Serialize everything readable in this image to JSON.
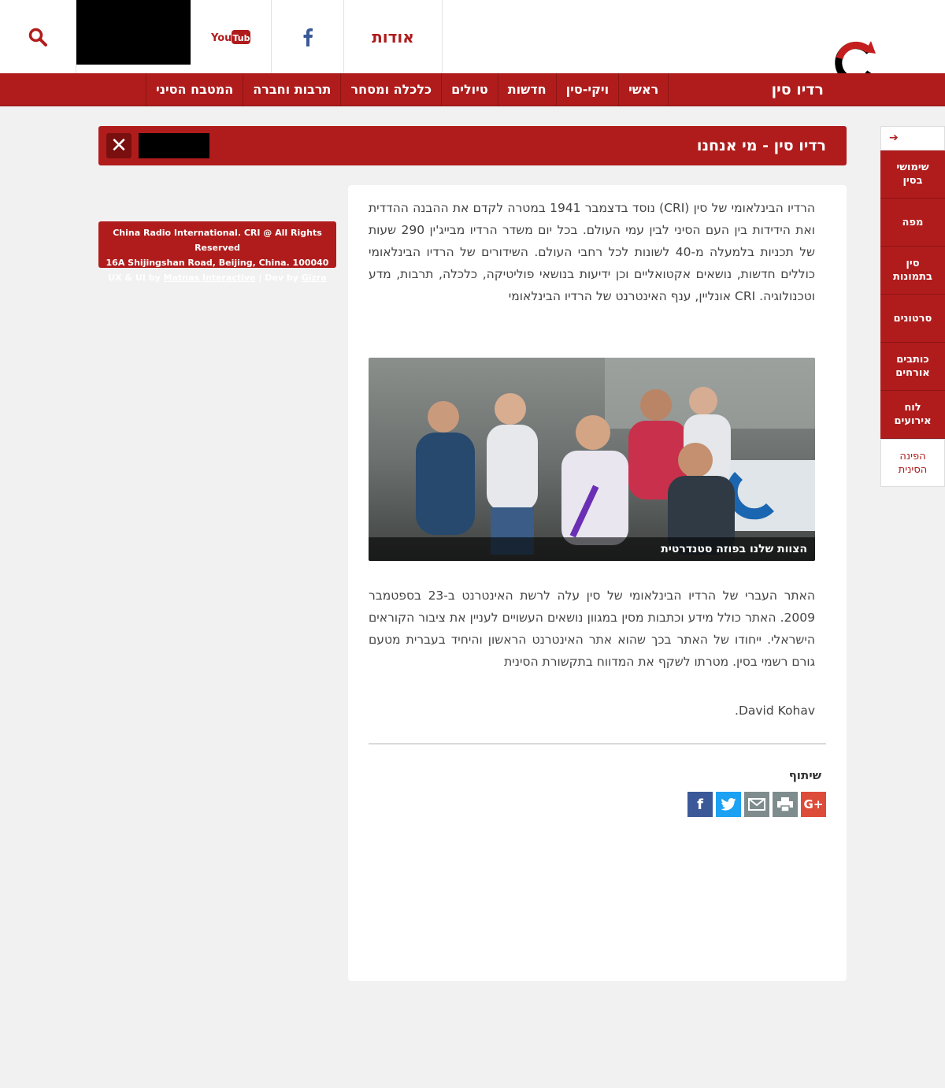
{
  "header": {
    "about_label": "אודות",
    "site_title": "רדיו סין"
  },
  "nav": {
    "items": [
      "ראשי",
      "ויקי-סין",
      "חדשות",
      "טיולים",
      "כלכלה ומסחר",
      "תרבות וחברה",
      "המטבח הסיני"
    ]
  },
  "page": {
    "title": "רדיו סין - מי אנחנו",
    "paragraph1": "הרדיו הבינלאומי של סין (CRI) נוסד בדצמבר 1941 במטרה לקדם את ההבנה ההדדית ואת הידידות בין העם הסיני לבין עמי העולם. בכל יום משדר הרדיו מבייג'ין 290 שעות של תכניות בלמעלה מ-40 לשונות לכל רחבי העולם. השידורים של הרדיו הבינלאומי כוללים חדשות, נושאים אקטואליים וכן ידיעות בנושאי פוליטיקה, כלכלה, תרבות, מדע וטכנולוגיה. CRI אונליין, ענף האינטרנט של הרדיו הבינלאומי",
    "photo_caption": "הצוות שלנו בפוזה סטנדרטית",
    "paragraph2": "האתר העברי של הרדיו הבינלאומי של סין עלה לרשת האינטרנט ב-23 בספטמבר 2009. האתר כולל מידע וכתבות מסין במגוון נושאים העשויים לעניין את ציבור הקוראים הישראלי. ייחודו של האתר בכך שהוא אתר האינטרנט הראשון והיחיד בעברית מטעם גורם רשמי בסין. מטרתו לשקף את המדווח בתקשורת הסינית",
    "signature": "David Kohav.",
    "share_label": "שיתוף"
  },
  "credits": {
    "line1": "China Radio International. CRI @ All Rights Reserved",
    "line2": "16A Shijingshan Road, Beijing, China. 100040",
    "line3_prefix": "UX & UI by ",
    "line3_link1": "Matnas Interactive",
    "line3_mid": " | Dev by ",
    "line3_link2": "Gizra"
  },
  "sidebar": {
    "items": [
      {
        "label": "שימושי בסין"
      },
      {
        "label": "מפה"
      },
      {
        "label": "סין בתמונות"
      },
      {
        "label": "סרטונים"
      },
      {
        "label": "כותבים אורחים"
      },
      {
        "label": "לוח אירועים"
      },
      {
        "label": "הפינה הסינית"
      }
    ]
  },
  "icons": {
    "search": "search-icon",
    "youtube": "youtube-icon",
    "facebook": "facebook-icon",
    "close": "close-icon",
    "arrow": "arrow-right-icon"
  },
  "colors": {
    "brand_red": "#b01c1c",
    "facebook": "#3b5998",
    "twitter": "#1da1f2",
    "email": "#7f8c8d",
    "print": "#7f8c8d",
    "gplus": "#dd4b39"
  }
}
